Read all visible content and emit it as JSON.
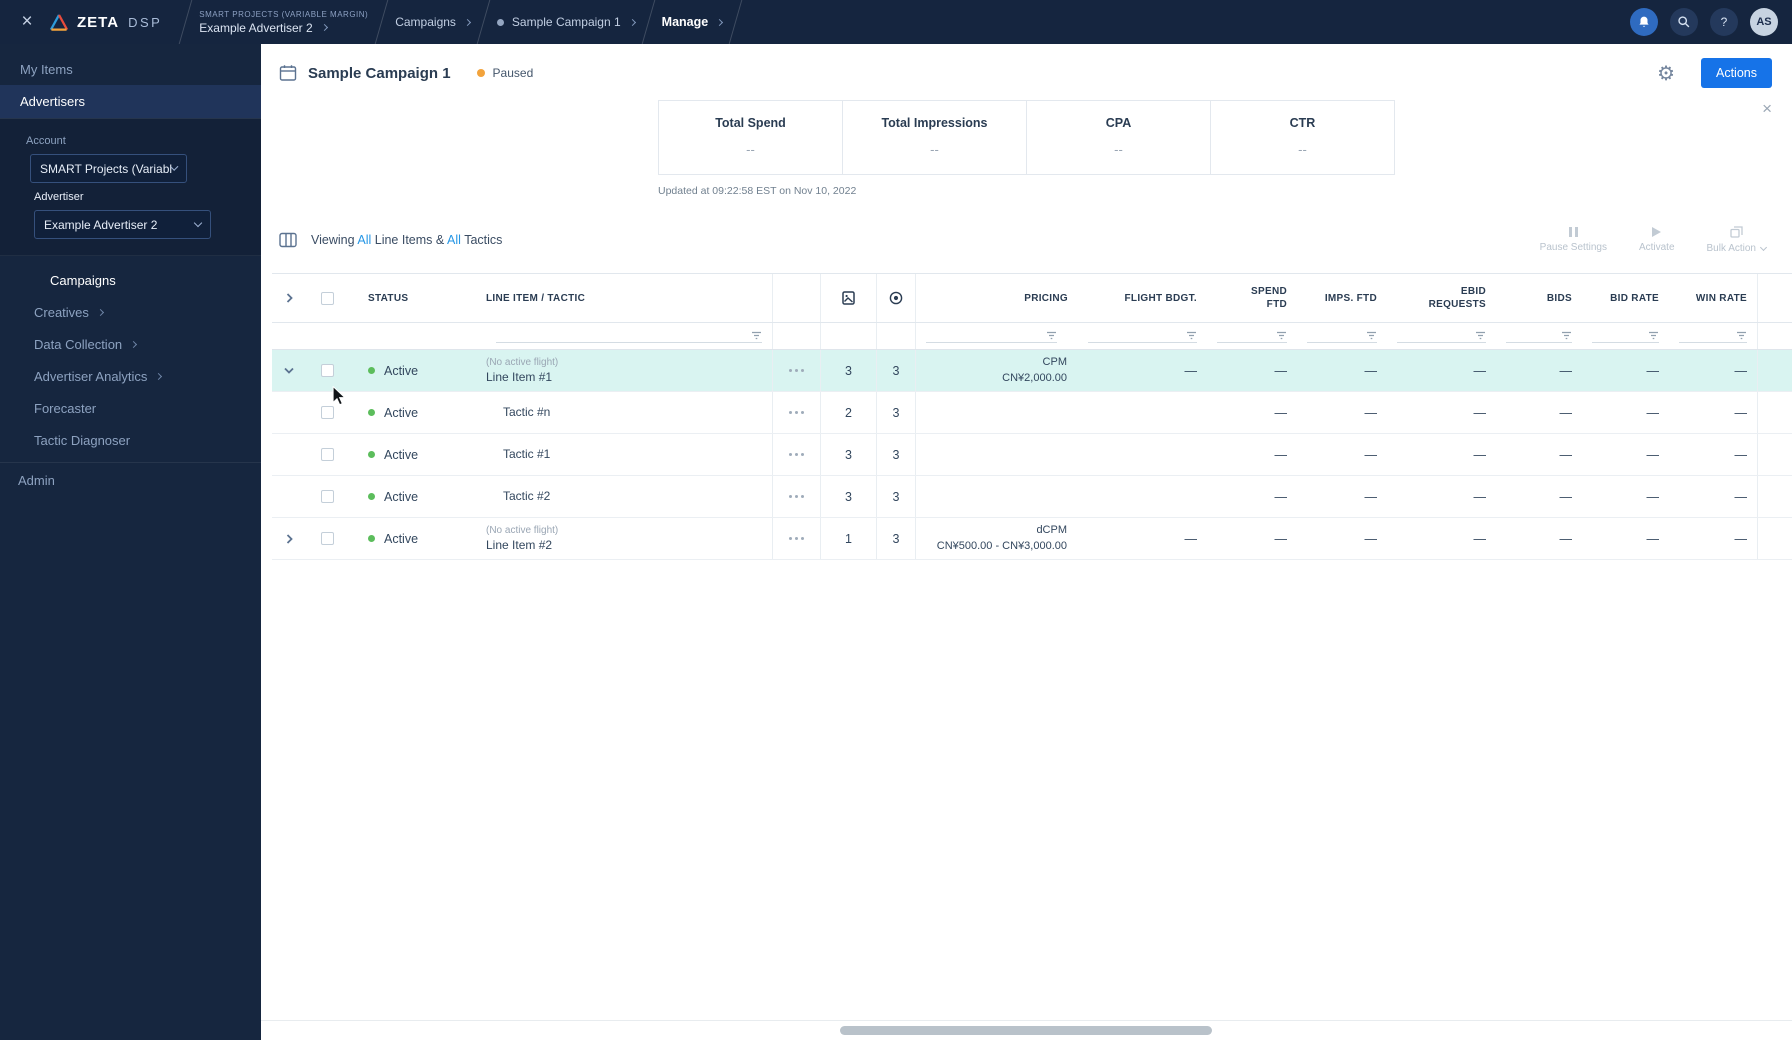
{
  "colors": {
    "topbar_navy": "#15253F",
    "sidebar_navy": "#16263F",
    "accent_blue": "#1673E8",
    "link_blue": "#2596E5",
    "active_green": "#5CBD5C",
    "paused_orange": "#F2A33C",
    "row_highlight": "#D9F4F1"
  },
  "topbar": {
    "logo_primary": "ZETA",
    "logo_secondary": "DSP",
    "breadcrumb": {
      "account_eyebrow": "SMART PROJECTS (VARIABLE MARGIN)",
      "advertiser": "Example Advertiser 2",
      "campaigns": "Campaigns",
      "campaign": "Sample Campaign 1",
      "manage": "Manage"
    },
    "help_label": "?",
    "avatar_initials": "AS"
  },
  "sidebar": {
    "my_items": "My Items",
    "advertisers": "Advertisers",
    "account_label": "Account",
    "account_value": "SMART Projects (Variable M...",
    "advertiser_label": "Advertiser",
    "advertiser_value": "Example Advertiser 2",
    "nav": {
      "campaigns": "Campaigns",
      "creatives": "Creatives",
      "data_collection": "Data Collection",
      "advertiser_analytics": "Advertiser Analytics",
      "forecaster": "Forecaster",
      "tactic_diagnoser": "Tactic Diagnoser",
      "admin": "Admin"
    }
  },
  "header": {
    "title": "Sample Campaign 1",
    "status": "Paused",
    "actions_button": "Actions"
  },
  "stats": {
    "items": [
      {
        "label": "Total Spend",
        "value": "--"
      },
      {
        "label": "Total Impressions",
        "value": "--"
      },
      {
        "label": "CPA",
        "value": "--"
      },
      {
        "label": "CTR",
        "value": "--"
      }
    ],
    "updated": "Updated at 09:22:58 EST on Nov 10, 2022"
  },
  "toolbar": {
    "viewing_prefix": "Viewing",
    "all_line_items": "All",
    "line_items_text": "Line Items &",
    "all_tactics": "All",
    "tactics_text": "Tactics",
    "pause_settings": "Pause Settings",
    "activate": "Activate",
    "bulk_action": "Bulk Action"
  },
  "table": {
    "headers": {
      "status": "STATUS",
      "line_item_tactic": "LINE ITEM / TACTIC",
      "pricing": "PRICING",
      "flight_bdgt": "FLIGHT BDGT.",
      "spend_ftd": "SPEND FTD",
      "imps_ftd": "IMPS. FTD",
      "ebid_requests": "EBID REQUESTS",
      "bids": "BIDS",
      "bid_rate": "BID RATE",
      "win_rate": "WIN RATE"
    },
    "rows": [
      {
        "status": "Active",
        "flight_note": "(No active flight)",
        "name": "Line Item #1",
        "creatives": "3",
        "targets": "3",
        "pricing_type": "CPM",
        "pricing_value": "CN¥2,000.00",
        "flight_bdgt": "—",
        "spend_ftd": "—",
        "imps_ftd": "—",
        "ebid_requests": "—",
        "bids": "—",
        "bid_rate": "—",
        "win_rate": "—"
      },
      {
        "status": "Active",
        "flight_note": "",
        "name": "Tactic #n",
        "creatives": "2",
        "targets": "3",
        "pricing_type": "",
        "pricing_value": "",
        "flight_bdgt": "",
        "spend_ftd": "—",
        "imps_ftd": "—",
        "ebid_requests": "—",
        "bids": "—",
        "bid_rate": "—",
        "win_rate": "—"
      },
      {
        "status": "Active",
        "flight_note": "",
        "name": "Tactic #1",
        "creatives": "3",
        "targets": "3",
        "pricing_type": "",
        "pricing_value": "",
        "flight_bdgt": "",
        "spend_ftd": "—",
        "imps_ftd": "—",
        "ebid_requests": "—",
        "bids": "—",
        "bid_rate": "—",
        "win_rate": "—"
      },
      {
        "status": "Active",
        "flight_note": "",
        "name": "Tactic #2",
        "creatives": "3",
        "targets": "3",
        "pricing_type": "",
        "pricing_value": "",
        "flight_bdgt": "",
        "spend_ftd": "—",
        "imps_ftd": "—",
        "ebid_requests": "—",
        "bids": "—",
        "bid_rate": "—",
        "win_rate": "—"
      },
      {
        "status": "Active",
        "flight_note": "(No active flight)",
        "name": "Line Item #2",
        "creatives": "1",
        "targets": "3",
        "pricing_type": "dCPM",
        "pricing_value": "CN¥500.00 - CN¥3,000.00",
        "flight_bdgt": "—",
        "spend_ftd": "—",
        "imps_ftd": "—",
        "ebid_requests": "—",
        "bids": "—",
        "bid_rate": "—",
        "win_rate": "—"
      }
    ]
  }
}
